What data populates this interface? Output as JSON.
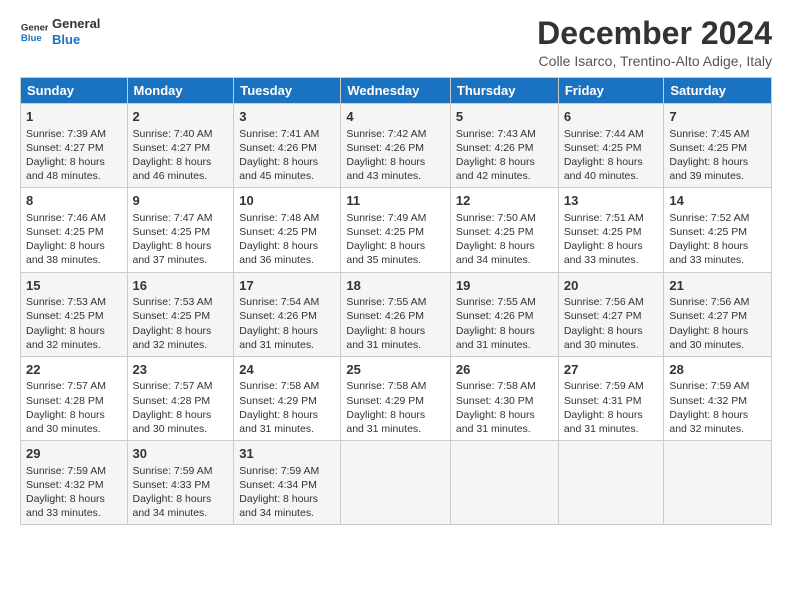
{
  "logo": {
    "line1": "General",
    "line2": "Blue"
  },
  "title": "December 2024",
  "subtitle": "Colle Isarco, Trentino-Alto Adige, Italy",
  "days_of_week": [
    "Sunday",
    "Monday",
    "Tuesday",
    "Wednesday",
    "Thursday",
    "Friday",
    "Saturday"
  ],
  "weeks": [
    [
      {
        "day": "1",
        "sunrise": "7:39 AM",
        "sunset": "4:27 PM",
        "daylight": "8 hours and 48 minutes."
      },
      {
        "day": "2",
        "sunrise": "7:40 AM",
        "sunset": "4:27 PM",
        "daylight": "8 hours and 46 minutes."
      },
      {
        "day": "3",
        "sunrise": "7:41 AM",
        "sunset": "4:26 PM",
        "daylight": "8 hours and 45 minutes."
      },
      {
        "day": "4",
        "sunrise": "7:42 AM",
        "sunset": "4:26 PM",
        "daylight": "8 hours and 43 minutes."
      },
      {
        "day": "5",
        "sunrise": "7:43 AM",
        "sunset": "4:26 PM",
        "daylight": "8 hours and 42 minutes."
      },
      {
        "day": "6",
        "sunrise": "7:44 AM",
        "sunset": "4:25 PM",
        "daylight": "8 hours and 40 minutes."
      },
      {
        "day": "7",
        "sunrise": "7:45 AM",
        "sunset": "4:25 PM",
        "daylight": "8 hours and 39 minutes."
      }
    ],
    [
      {
        "day": "8",
        "sunrise": "7:46 AM",
        "sunset": "4:25 PM",
        "daylight": "8 hours and 38 minutes."
      },
      {
        "day": "9",
        "sunrise": "7:47 AM",
        "sunset": "4:25 PM",
        "daylight": "8 hours and 37 minutes."
      },
      {
        "day": "10",
        "sunrise": "7:48 AM",
        "sunset": "4:25 PM",
        "daylight": "8 hours and 36 minutes."
      },
      {
        "day": "11",
        "sunrise": "7:49 AM",
        "sunset": "4:25 PM",
        "daylight": "8 hours and 35 minutes."
      },
      {
        "day": "12",
        "sunrise": "7:50 AM",
        "sunset": "4:25 PM",
        "daylight": "8 hours and 34 minutes."
      },
      {
        "day": "13",
        "sunrise": "7:51 AM",
        "sunset": "4:25 PM",
        "daylight": "8 hours and 33 minutes."
      },
      {
        "day": "14",
        "sunrise": "7:52 AM",
        "sunset": "4:25 PM",
        "daylight": "8 hours and 33 minutes."
      }
    ],
    [
      {
        "day": "15",
        "sunrise": "7:53 AM",
        "sunset": "4:25 PM",
        "daylight": "8 hours and 32 minutes."
      },
      {
        "day": "16",
        "sunrise": "7:53 AM",
        "sunset": "4:25 PM",
        "daylight": "8 hours and 32 minutes."
      },
      {
        "day": "17",
        "sunrise": "7:54 AM",
        "sunset": "4:26 PM",
        "daylight": "8 hours and 31 minutes."
      },
      {
        "day": "18",
        "sunrise": "7:55 AM",
        "sunset": "4:26 PM",
        "daylight": "8 hours and 31 minutes."
      },
      {
        "day": "19",
        "sunrise": "7:55 AM",
        "sunset": "4:26 PM",
        "daylight": "8 hours and 31 minutes."
      },
      {
        "day": "20",
        "sunrise": "7:56 AM",
        "sunset": "4:27 PM",
        "daylight": "8 hours and 30 minutes."
      },
      {
        "day": "21",
        "sunrise": "7:56 AM",
        "sunset": "4:27 PM",
        "daylight": "8 hours and 30 minutes."
      }
    ],
    [
      {
        "day": "22",
        "sunrise": "7:57 AM",
        "sunset": "4:28 PM",
        "daylight": "8 hours and 30 minutes."
      },
      {
        "day": "23",
        "sunrise": "7:57 AM",
        "sunset": "4:28 PM",
        "daylight": "8 hours and 30 minutes."
      },
      {
        "day": "24",
        "sunrise": "7:58 AM",
        "sunset": "4:29 PM",
        "daylight": "8 hours and 31 minutes."
      },
      {
        "day": "25",
        "sunrise": "7:58 AM",
        "sunset": "4:29 PM",
        "daylight": "8 hours and 31 minutes."
      },
      {
        "day": "26",
        "sunrise": "7:58 AM",
        "sunset": "4:30 PM",
        "daylight": "8 hours and 31 minutes."
      },
      {
        "day": "27",
        "sunrise": "7:59 AM",
        "sunset": "4:31 PM",
        "daylight": "8 hours and 31 minutes."
      },
      {
        "day": "28",
        "sunrise": "7:59 AM",
        "sunset": "4:32 PM",
        "daylight": "8 hours and 32 minutes."
      }
    ],
    [
      {
        "day": "29",
        "sunrise": "7:59 AM",
        "sunset": "4:32 PM",
        "daylight": "8 hours and 33 minutes."
      },
      {
        "day": "30",
        "sunrise": "7:59 AM",
        "sunset": "4:33 PM",
        "daylight": "8 hours and 34 minutes."
      },
      {
        "day": "31",
        "sunrise": "7:59 AM",
        "sunset": "4:34 PM",
        "daylight": "8 hours and 34 minutes."
      },
      null,
      null,
      null,
      null
    ]
  ],
  "labels": {
    "sunrise": "Sunrise:",
    "sunset": "Sunset:",
    "daylight": "Daylight:"
  }
}
